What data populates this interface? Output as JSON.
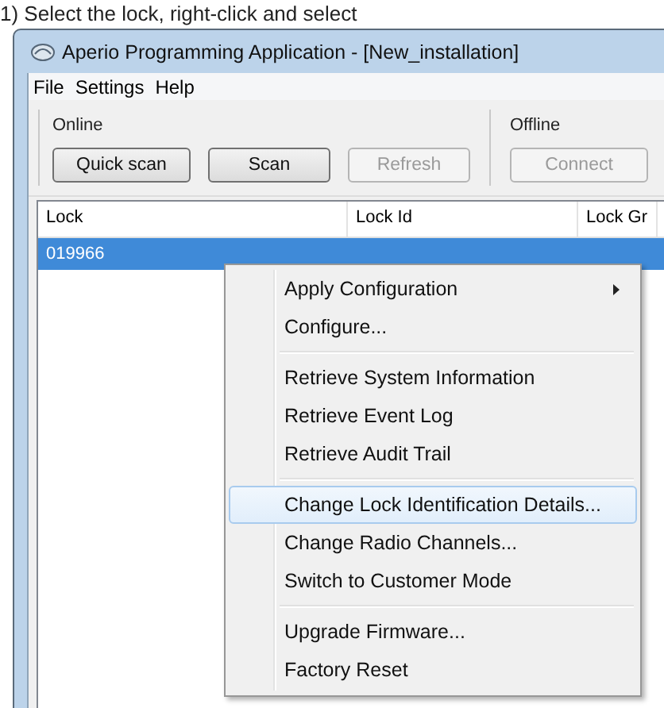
{
  "caption": "1)  Select the lock, right-click and select",
  "window": {
    "title": "Aperio Programming Application - [New_installation]"
  },
  "menu": [
    "File",
    "Settings",
    "Help"
  ],
  "groups": [
    {
      "label": "Online",
      "buttons": [
        {
          "label": "Quick scan",
          "disabled": false
        },
        {
          "label": "Scan",
          "disabled": false
        },
        {
          "label": "Refresh",
          "disabled": true
        }
      ]
    },
    {
      "label": "Offline",
      "buttons": [
        {
          "label": "Connect",
          "disabled": true
        }
      ]
    }
  ],
  "table": {
    "columns": [
      "Lock",
      "Lock Id",
      "Lock Gr"
    ],
    "rows": [
      {
        "cells": [
          "019966"
        ],
        "selected": true
      }
    ]
  },
  "context_menu": {
    "items": [
      {
        "kind": "item",
        "label": "Apply Configuration",
        "submenu": true,
        "selected": false
      },
      {
        "kind": "item",
        "label": "Configure...",
        "submenu": false,
        "selected": false
      },
      {
        "kind": "separator"
      },
      {
        "kind": "item",
        "label": "Retrieve System Information",
        "submenu": false,
        "selected": false
      },
      {
        "kind": "item",
        "label": "Retrieve Event Log",
        "submenu": false,
        "selected": false
      },
      {
        "kind": "item",
        "label": "Retrieve Audit Trail",
        "submenu": false,
        "selected": false
      },
      {
        "kind": "separator"
      },
      {
        "kind": "item",
        "label": "Change Lock Identification Details...",
        "submenu": false,
        "selected": true
      },
      {
        "kind": "item",
        "label": "Change Radio Channels...",
        "submenu": false,
        "selected": false
      },
      {
        "kind": "item",
        "label": "Switch to Customer Mode",
        "submenu": false,
        "selected": false
      },
      {
        "kind": "separator"
      },
      {
        "kind": "item",
        "label": "Upgrade Firmware...",
        "submenu": false,
        "selected": false
      },
      {
        "kind": "item",
        "label": "Factory Reset",
        "submenu": false,
        "selected": false
      }
    ]
  }
}
